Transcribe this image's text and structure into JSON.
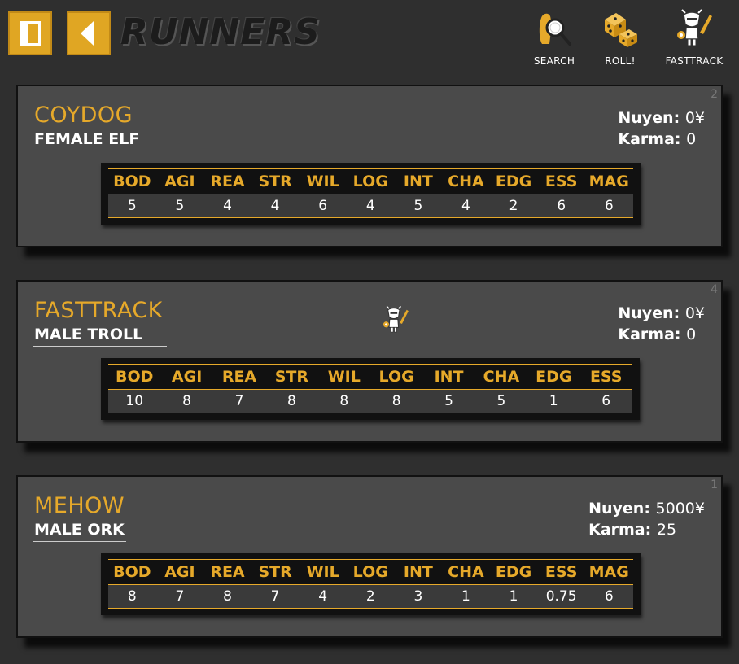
{
  "header": {
    "title": "RUNNERS",
    "tools": [
      {
        "label": "SEARCH",
        "icon": "search-icon"
      },
      {
        "label": "ROLL!",
        "icon": "dice-icon"
      },
      {
        "label": "FASTTRACK",
        "icon": "troll-icon"
      }
    ]
  },
  "colors": {
    "accent": "#e6a92a",
    "card": "#4a4a4a",
    "background": "#2f2f2f"
  },
  "cards": [
    {
      "num": "2",
      "name": "COYDOG",
      "meta": "FEMALE ELF",
      "nuyen_label": "Nuyen:",
      "nuyen": "0¥",
      "karma_label": "Karma:",
      "karma": "0",
      "stats_headers": [
        "BOD",
        "AGI",
        "REA",
        "STR",
        "WIL",
        "LOG",
        "INT",
        "CHA",
        "EDG",
        "ESS",
        "MAG"
      ],
      "stats_values": [
        "5",
        "5",
        "4",
        "4",
        "6",
        "4",
        "5",
        "4",
        "2",
        "6",
        "6"
      ]
    },
    {
      "num": "4",
      "name": "FASTTRACK",
      "meta": "MALE TROLL",
      "badge": "troll-icon",
      "nuyen_label": "Nuyen:",
      "nuyen": "0¥",
      "karma_label": "Karma:",
      "karma": "0",
      "stats_headers": [
        "BOD",
        "AGI",
        "REA",
        "STR",
        "WIL",
        "LOG",
        "INT",
        "CHA",
        "EDG",
        "ESS"
      ],
      "stats_values": [
        "10",
        "8",
        "7",
        "8",
        "8",
        "8",
        "5",
        "5",
        "1",
        "6"
      ]
    },
    {
      "num": "1",
      "name": "MEHOW",
      "meta": "MALE ORK",
      "nuyen_label": "Nuyen:",
      "nuyen": "5000¥",
      "karma_label": "Karma:",
      "karma": "25",
      "stats_headers": [
        "BOD",
        "AGI",
        "REA",
        "STR",
        "WIL",
        "LOG",
        "INT",
        "CHA",
        "EDG",
        "ESS",
        "MAG"
      ],
      "stats_values": [
        "8",
        "7",
        "8",
        "7",
        "4",
        "2",
        "3",
        "1",
        "1",
        "0.75",
        "6"
      ]
    }
  ]
}
